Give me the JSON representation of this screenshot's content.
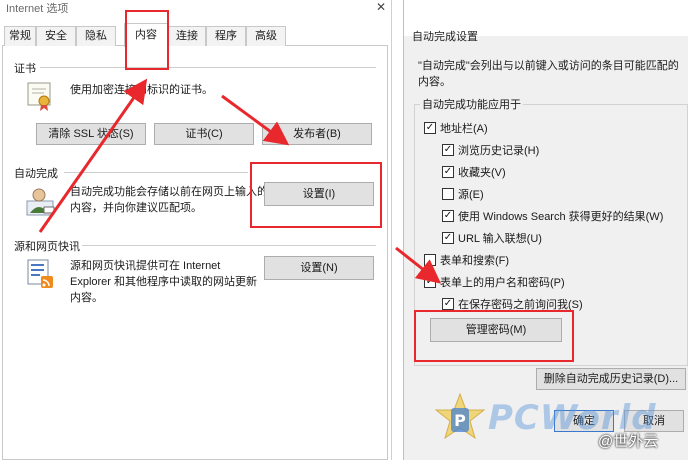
{
  "left_dialog": {
    "title": "Internet 选项",
    "close_glyph": "✕",
    "tabs": [
      {
        "label": "常规"
      },
      {
        "label": "安全"
      },
      {
        "label": "隐私"
      },
      {
        "label": "内容"
      },
      {
        "label": "连接"
      },
      {
        "label": "程序"
      },
      {
        "label": "高级"
      }
    ],
    "active_tab": "内容",
    "certificates": {
      "title": "证书",
      "description": "使用加密连接和标识的证书。",
      "clear_ssl_button": "清除 SSL 状态(S)",
      "certificates_button": "证书(C)",
      "publishers_button": "发布者(B)"
    },
    "autocomplete": {
      "title": "自动完成",
      "description_line1": "自动完成功能会存储以前在网页上输入的",
      "description_line2": "内容，并向你建议匹配项。",
      "settings_button": "设置(I)"
    },
    "feeds": {
      "title": "源和网页快讯",
      "description_line1": "源和网页快讯提供可在 Internet",
      "description_line2": "Explorer 和其他程序中读取的网站更新",
      "description_line3": "内容。",
      "settings_button": "设置(N)"
    }
  },
  "right_dialog": {
    "title": "自动完成设置",
    "intro": "\"自动完成\"会列出与以前键入或访问的条目可能匹配的内容。",
    "group_label": "自动完成功能应用于",
    "options": [
      {
        "label": "地址栏(A)",
        "checked": true
      },
      {
        "label": "浏览历史记录(H)",
        "checked": true
      },
      {
        "label": "收藏夹(V)",
        "checked": true
      },
      {
        "label": "源(E)",
        "checked": false
      },
      {
        "label": "使用 Windows Search 获得更好的结果(W)",
        "checked": true
      },
      {
        "label": "URL 输入联想(U)",
        "checked": true
      },
      {
        "label": "表单和搜索(F)",
        "checked": false
      },
      {
        "label": "表单上的用户名和密码(P)",
        "checked": true
      },
      {
        "label": "在保存密码之前询问我(S)",
        "checked": true
      }
    ],
    "manage_passwords_button": "管理密码(M)",
    "delete_history_button": "删除自动完成历史记录(D)...",
    "ok_button": "确定",
    "cancel_button": "取消"
  },
  "watermark": {
    "brand": "PCWorld",
    "credit": "@世外云"
  },
  "colors": {
    "annotation_red": "#e8282c",
    "button_face": "#e1e1e1",
    "dialog_bg": "#f0f0f0"
  }
}
